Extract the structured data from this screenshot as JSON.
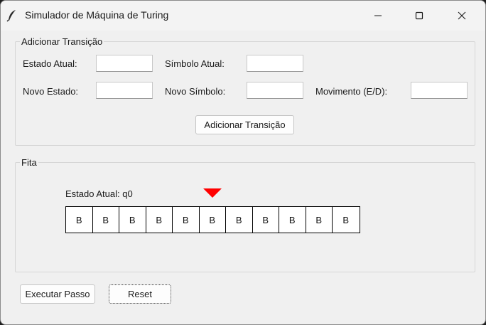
{
  "window": {
    "title": "Simulador de Máquina de Turing",
    "icon": "feather-icon"
  },
  "transition_group": {
    "legend": "Adicionar Transição",
    "labels": {
      "estado_atual": "Estado Atual:",
      "simbolo_atual": "Símbolo Atual:",
      "novo_estado": "Novo Estado:",
      "novo_simbolo": "Novo Símbolo:",
      "movimento": "Movimento (E/D):"
    },
    "values": {
      "estado_atual": "",
      "simbolo_atual": "",
      "novo_estado": "",
      "novo_simbolo": "",
      "movimento": ""
    },
    "add_button": "Adicionar Transição"
  },
  "tape_group": {
    "legend": "Fita",
    "current_state": "Estado Atual: q0",
    "cells": [
      "B",
      "B",
      "B",
      "B",
      "B",
      "B",
      "B",
      "B",
      "B",
      "B",
      "B"
    ],
    "head_index": 5,
    "head_color": "#ff0000"
  },
  "actions": {
    "step": "Executar Passo",
    "reset": "Reset"
  }
}
